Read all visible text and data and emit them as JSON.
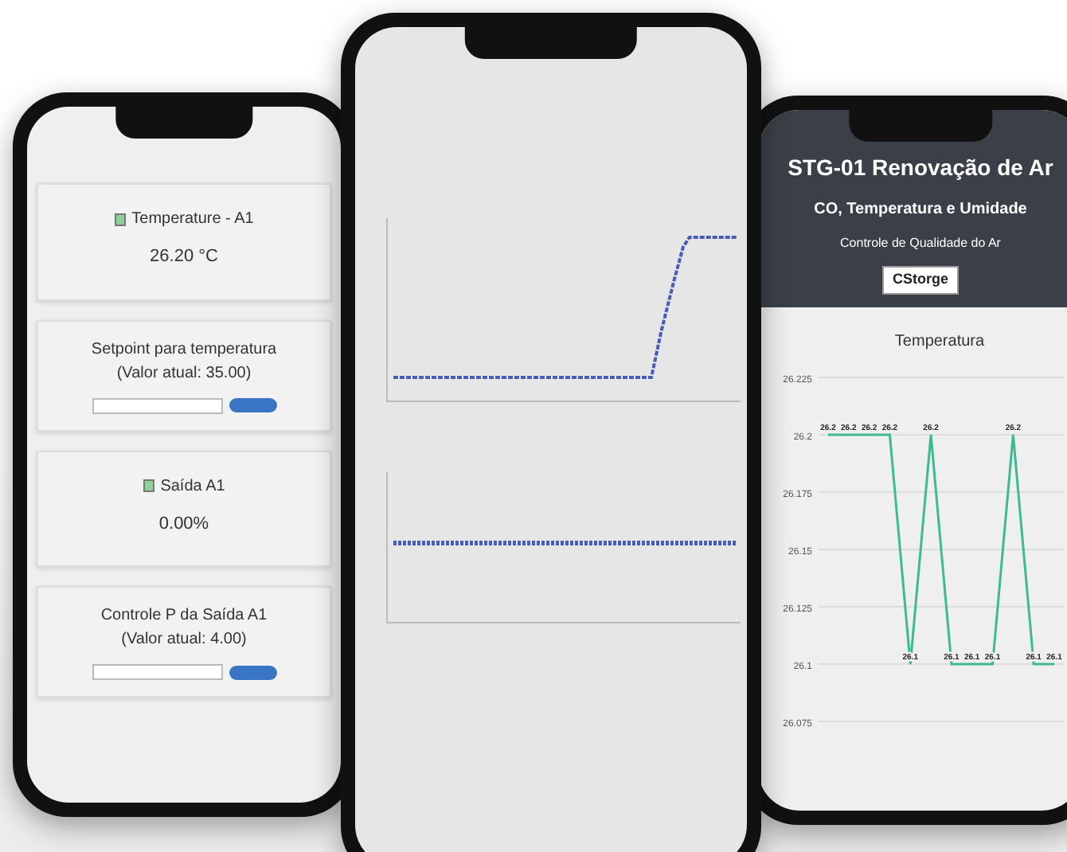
{
  "phones": [
    {
      "kind": "dashboard",
      "cards": [
        {
          "kind": "reading",
          "title": "Temperature - A1",
          "value": "26.20 °C"
        },
        {
          "kind": "setpoint",
          "title": "Setpoint para temperatura",
          "subtitle": "(Valor atual: 35.00)"
        },
        {
          "kind": "reading",
          "title": "Saída A1",
          "value": "0.00%"
        },
        {
          "kind": "setpoint",
          "title": "Controle P da Saída A1",
          "subtitle": "(Valor atual: 4.00)"
        }
      ]
    },
    {
      "kind": "charts"
    },
    {
      "kind": "report",
      "title": "STG-01 Renovação de Ar",
      "subtitle": "CO, Temperatura e Umidade",
      "caption": "Controle de Qualidade do Ar",
      "logo": "CStorge",
      "chart_data": {
        "type": "line",
        "title": "Temperatura",
        "ylim": [
          26.075,
          26.225
        ],
        "yticks": [
          26.075,
          26.1,
          26.125,
          26.15,
          26.175,
          26.2,
          26.225
        ],
        "data_labels": true,
        "grid": true,
        "series": [
          {
            "color": "#3db996",
            "values": [
              26.2,
              26.2,
              26.2,
              26.2,
              26.1,
              26.2,
              26.1,
              26.1,
              26.1,
              26.2,
              26.1,
              26.1
            ]
          }
        ]
      }
    }
  ]
}
